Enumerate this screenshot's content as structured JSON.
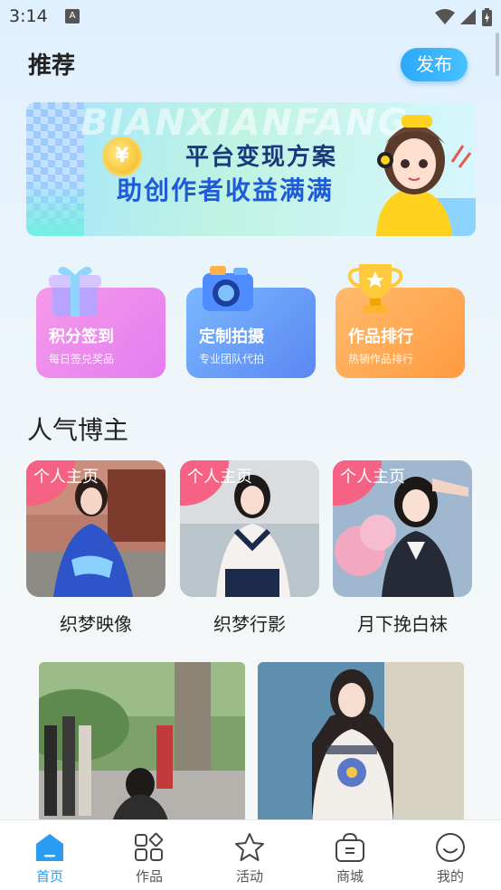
{
  "status": {
    "time": "3:14",
    "indicator": "A"
  },
  "header": {
    "title": "推荐",
    "publish_label": "发布"
  },
  "banner": {
    "bg_text": "BIANXIANFANG",
    "line1": "平台变现方案",
    "line2": "助创作者收益满满",
    "coin_symbol": "¥"
  },
  "features": [
    {
      "title": "积分签到",
      "subtitle": "每日签兑奖品",
      "icon": "gift-box-icon"
    },
    {
      "title": "定制拍摄",
      "subtitle": "专业团队代拍",
      "icon": "camera-icon"
    },
    {
      "title": "作品排行",
      "subtitle": "热销作品排行",
      "icon": "trophy-icon"
    }
  ],
  "popular": {
    "title": "人气博主",
    "bloggers": [
      {
        "tag": "个人主页",
        "name": "织梦映像"
      },
      {
        "tag": "个人主页",
        "name": "织梦行影"
      },
      {
        "tag": "个人主页",
        "name": "月下挽白袜"
      }
    ]
  },
  "tabbar": {
    "items": [
      {
        "label": "首页",
        "icon": "home-icon",
        "active": true
      },
      {
        "label": "作品",
        "icon": "works-grid-icon",
        "active": false
      },
      {
        "label": "活动",
        "icon": "star-icon",
        "active": false
      },
      {
        "label": "商城",
        "icon": "shopping-bag-icon",
        "active": false
      },
      {
        "label": "我的",
        "icon": "smile-face-icon",
        "active": false
      }
    ]
  },
  "colors": {
    "accent": "#2b9cf2",
    "tag_pink": "#f56283"
  }
}
